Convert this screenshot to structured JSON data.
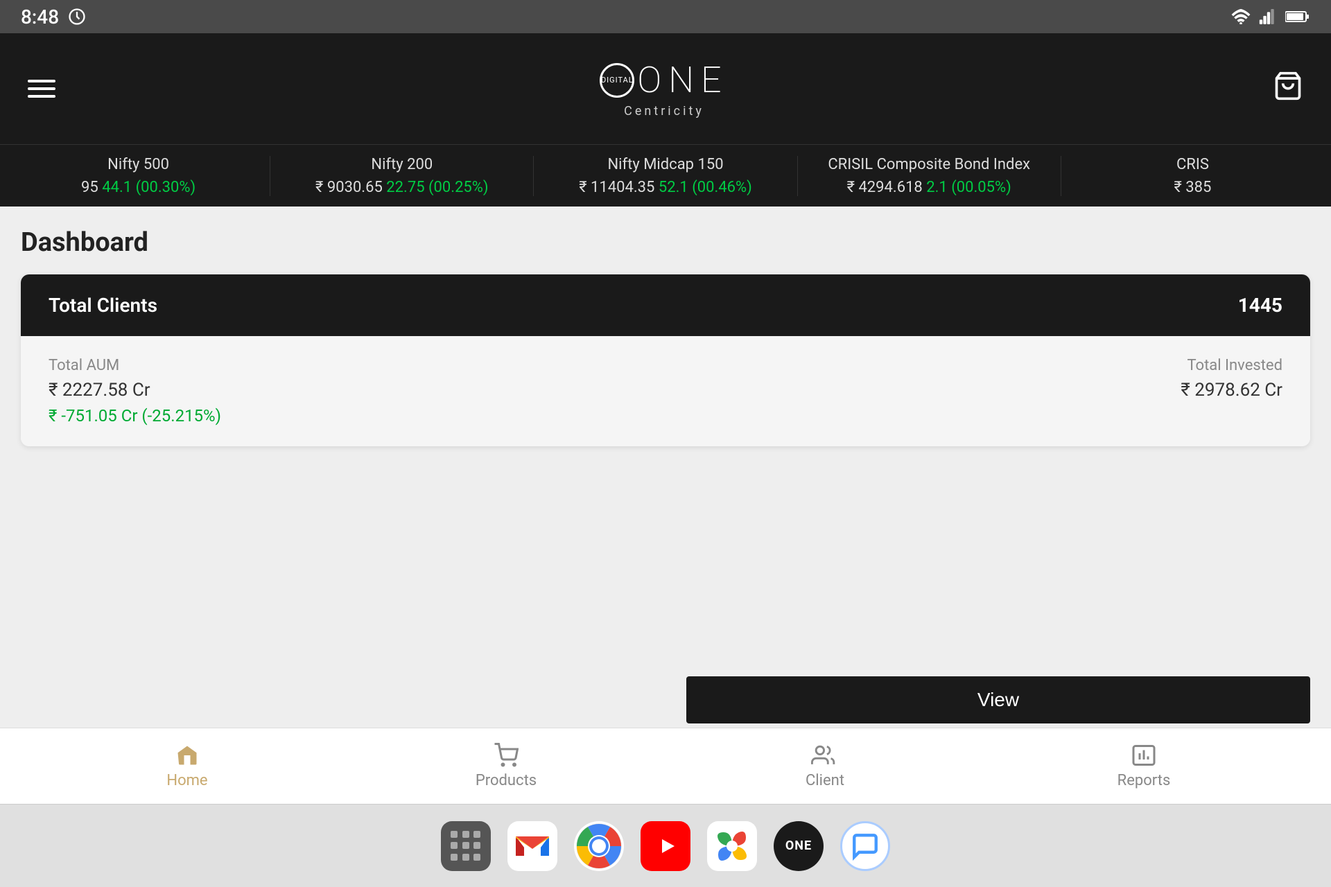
{
  "statusBar": {
    "time": "8:48",
    "icons": [
      "wifi",
      "signal",
      "battery"
    ]
  },
  "header": {
    "menuLabel": "menu",
    "logoLine1": "ONE",
    "logoDigital": "DIGITAL",
    "logoCentricity": "Centricity",
    "cartLabel": "cart"
  },
  "ticker": {
    "items": [
      {
        "name": "Nifty 500",
        "price": "95",
        "change": "44.1 (00.30%)",
        "changeSign": "+"
      },
      {
        "name": "Nifty 200",
        "price": "₹ 9030.65",
        "change": "22.75 (00.25%)",
        "changeSign": "+"
      },
      {
        "name": "Nifty Midcap 150",
        "price": "₹ 11404.35",
        "change": "52.1 (00.46%)",
        "changeSign": "+"
      },
      {
        "name": "CRISIL Composite Bond Index",
        "price": "₹ 4294.618",
        "change": "2.1 (00.05%)",
        "changeSign": "+"
      },
      {
        "name": "CRIS",
        "price": "₹ 385",
        "change": "",
        "changeSign": ""
      }
    ]
  },
  "dashboard": {
    "pageTitle": "Dashboard",
    "card": {
      "headerTitle": "Total Clients",
      "headerValue": "1445",
      "totalAumLabel": "Total AUM",
      "totalAumValue": "₹ 2227.58 Cr",
      "totalAumChange": "₹ -751.05 Cr (-25.215%)",
      "totalInvestedLabel": "Total Invested",
      "totalInvestedValue": "₹ 2978.62 Cr",
      "viewButton": "View"
    }
  },
  "bottomNav": {
    "items": [
      {
        "id": "home",
        "label": "Home",
        "icon": "🏠",
        "active": true
      },
      {
        "id": "products",
        "label": "Products",
        "icon": "🛒",
        "active": false
      },
      {
        "id": "client",
        "label": "Client",
        "icon": "👥",
        "active": false
      },
      {
        "id": "reports",
        "label": "Reports",
        "icon": "📊",
        "active": false
      }
    ]
  },
  "appDock": {
    "apps": [
      {
        "id": "grid",
        "label": "App Grid"
      },
      {
        "id": "gmail",
        "label": "Gmail"
      },
      {
        "id": "chrome",
        "label": "Chrome"
      },
      {
        "id": "youtube",
        "label": "YouTube"
      },
      {
        "id": "photos",
        "label": "Google Photos"
      },
      {
        "id": "one",
        "label": "ONE"
      },
      {
        "id": "messages",
        "label": "Messages"
      }
    ]
  },
  "colors": {
    "accent": "#c8a96e",
    "positive": "#00cc44",
    "dark": "#1a1a1a",
    "background": "#eeeeee"
  }
}
